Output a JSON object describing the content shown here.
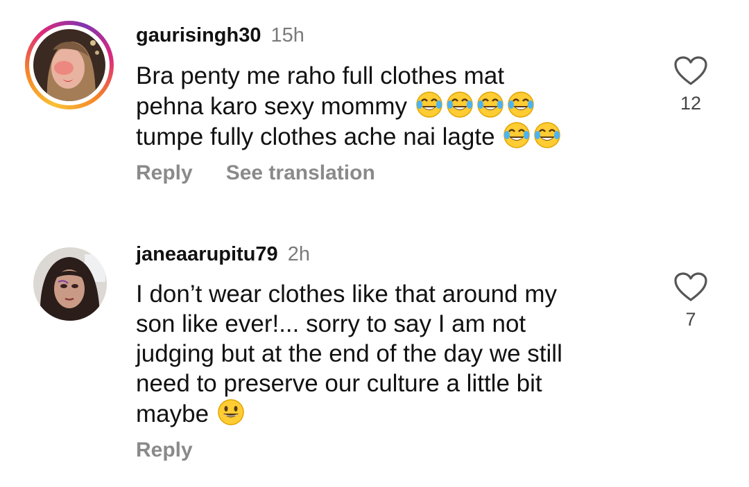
{
  "comments": [
    {
      "username": "gaurisingh30",
      "time": "15h",
      "lines": [
        "Bra penty me raho full clothes mat",
        "pehna karo sexy mommy",
        "tumpe fully clothes ache nai lagte"
      ],
      "likes": "12",
      "reply_label": "Reply",
      "translate_label": "See translation",
      "has_story_ring": true,
      "emoji": "face-with-tears-of-joy"
    },
    {
      "username": "janeaarupitu79",
      "time": "2h",
      "lines": [
        "I don’t wear clothes like that around my",
        "son like ever!... sorry to say I am not",
        "judging but at the end of the day we still",
        "need to preserve our culture a little bit",
        "maybe"
      ],
      "likes": "7",
      "reply_label": "Reply",
      "has_story_ring": false,
      "emoji": "grinning-face"
    }
  ],
  "colors": {
    "username": "#111111",
    "timestamp": "#7a7a7a",
    "action": "#8a8a8a",
    "ring_gradient": [
      "#f9c134",
      "#f58529",
      "#dd2a7b",
      "#8134af"
    ]
  },
  "icons": {
    "like": "heart-outline-icon",
    "emoji_joy": "face-with-tears-of-joy",
    "emoji_grin": "grinning-face"
  }
}
